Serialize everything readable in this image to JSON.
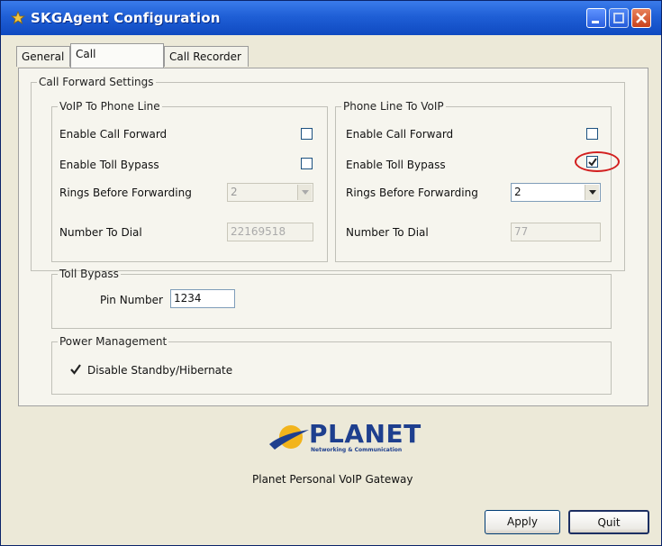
{
  "window": {
    "title": "SKGAgent Configuration"
  },
  "tabs": [
    {
      "label": "General"
    },
    {
      "label": "Call Forwarding",
      "active": true
    },
    {
      "label": "Call Recorder"
    }
  ],
  "call_forward_settings": {
    "legend": "Call Forward Settings",
    "voip_to_phone": {
      "legend": "VoIP To Phone Line",
      "enable_call_forward_label": "Enable Call Forward",
      "enable_call_forward": false,
      "enable_toll_bypass_label": "Enable Toll Bypass",
      "enable_toll_bypass": false,
      "rings_label": "Rings Before Forwarding",
      "rings_value": "2",
      "number_label": "Number To Dial",
      "number_value": "22169518"
    },
    "phone_to_voip": {
      "legend": "Phone Line To VoIP",
      "enable_call_forward_label": "Enable Call Forward",
      "enable_call_forward": false,
      "enable_toll_bypass_label": "Enable Toll Bypass",
      "enable_toll_bypass": true,
      "rings_label": "Rings Before Forwarding",
      "rings_value": "2",
      "number_label": "Number To Dial",
      "number_value": "77"
    }
  },
  "toll_bypass": {
    "legend": "Toll Bypass",
    "pin_label": "Pin Number",
    "pin_value": "1234"
  },
  "power_management": {
    "legend": "Power Management",
    "disable_standby_label": "Disable Standby/Hibernate",
    "disable_standby": true
  },
  "branding": {
    "logo_text": "PLANET",
    "logo_tagline": "Networking & Communication",
    "caption": "Planet Personal VoIP Gateway"
  },
  "buttons": {
    "apply": "Apply",
    "quit": "Quit"
  },
  "colors": {
    "titlebar": "#1f5fd6",
    "highlight": "#d21f1f",
    "logo": "#1e3f8e"
  }
}
